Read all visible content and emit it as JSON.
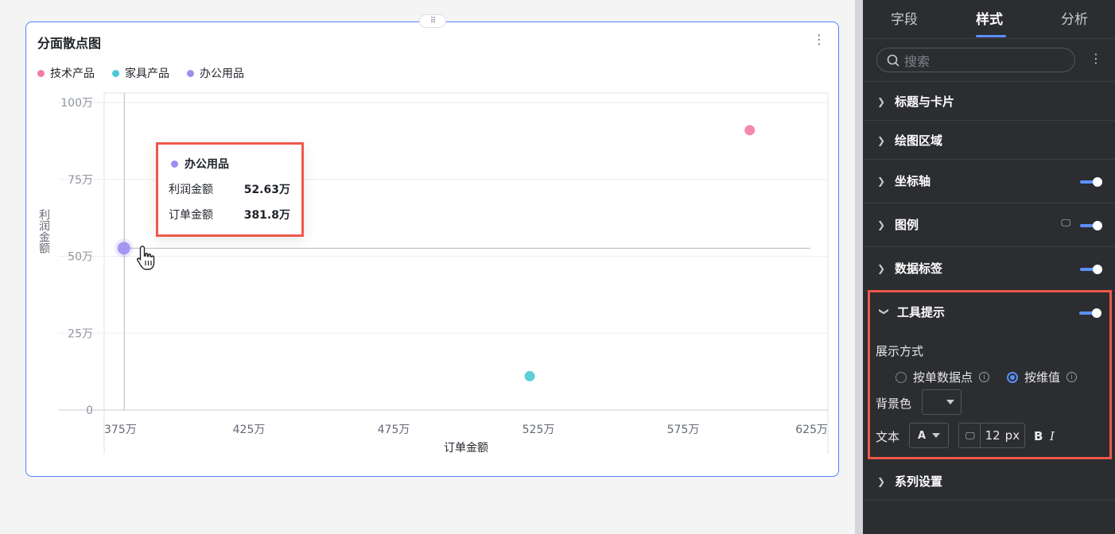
{
  "card": {
    "title": "分面散点图",
    "drag_handle": "⠿"
  },
  "legend": [
    {
      "label": "技术产品",
      "color": "#f47ca0"
    },
    {
      "label": "家具产品",
      "color": "#4cc9d6"
    },
    {
      "label": "办公用品",
      "color": "#9d8ef0"
    }
  ],
  "chart_data": {
    "type": "scatter",
    "xlabel": "订单金额",
    "ylabel": "利润金额",
    "xlim": [
      375,
      625
    ],
    "ylim": [
      0,
      100
    ],
    "x_ticks": [
      "375万",
      "425万",
      "475万",
      "525万",
      "575万",
      "625万"
    ],
    "y_ticks": [
      "0",
      "25万",
      "50万",
      "75万",
      "100万"
    ],
    "series": [
      {
        "name": "技术产品",
        "color": "#f47ca0",
        "points": [
          {
            "x": 598,
            "y": 91
          }
        ]
      },
      {
        "name": "家具产品",
        "color": "#4cc9d6",
        "points": [
          {
            "x": 522,
            "y": 11
          }
        ]
      },
      {
        "name": "办公用品",
        "color": "#9d8ef0",
        "points": [
          {
            "x": 381.8,
            "y": 52.63
          }
        ]
      }
    ]
  },
  "tooltip": {
    "title": "办公用品",
    "color": "#9d8ef0",
    "rows": [
      {
        "label": "利润金额",
        "value": "52.63万"
      },
      {
        "label": "订单金额",
        "value": "381.8万"
      }
    ]
  },
  "panel": {
    "tabs": [
      "字段",
      "样式",
      "分析"
    ],
    "active_tab": "样式",
    "search_placeholder": "搜索",
    "sections": {
      "title_card": "标题与卡片",
      "plot_area": "绘图区域",
      "axis": "坐标轴",
      "legend": "图例",
      "data_label": "数据标签",
      "tooltip": "工具提示",
      "series": "系列设置"
    },
    "tooltip_settings": {
      "display_mode_label": "展示方式",
      "option_single": "按单数据点",
      "option_dimension": "按维值",
      "selected": "按维值",
      "bg_color_label": "背景色",
      "text_label": "文本",
      "font_color_glyph": "A",
      "font_size": "12",
      "font_unit": "px",
      "bold": "B",
      "italic": "I"
    }
  }
}
